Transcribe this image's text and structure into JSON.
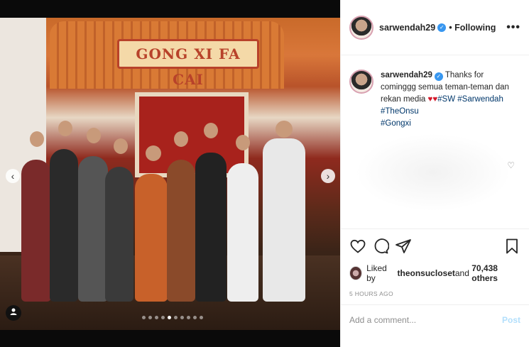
{
  "photo": {
    "sign_text": "GONG XI FA CAI",
    "nav_prev": "‹",
    "nav_next": "›",
    "carousel_count": 10,
    "carousel_active": 4
  },
  "header": {
    "username": "sarwendah29",
    "following_label": "• Following",
    "more_label": "•••"
  },
  "caption": {
    "username": "sarwendah29",
    "line1": " Thanks for cominggg semua teman-teman dan rekan media ",
    "hearts": "♥♥",
    "hashtags": [
      "#SW",
      "#Sarwendah",
      "#TheOnsu",
      "#Gongxi"
    ]
  },
  "engagement": {
    "liked_prefix": "Liked by ",
    "liked_user": "theonsucloset",
    "liked_mid": " and ",
    "liked_count": "70,438 others",
    "timestamp": "5 HOURS AGO"
  },
  "comment_box": {
    "placeholder": "Add a comment...",
    "post_label": "Post"
  },
  "colors": {
    "link": "#00376b",
    "verified": "#3897f0",
    "post_disabled": "#b2dffc"
  }
}
